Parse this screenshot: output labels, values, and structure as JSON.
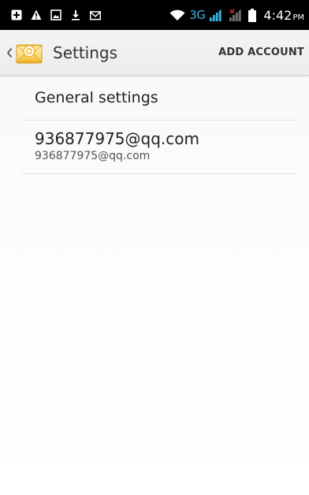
{
  "status_bar": {
    "left_icons": [
      "plus-badge-icon",
      "warning-icon",
      "image-icon",
      "download-icon",
      "gmail-icon"
    ],
    "network_type": "3G",
    "time": "4:42",
    "ampm": "PM",
    "accent_color": "#33b5e5"
  },
  "action_bar": {
    "title": "Settings",
    "action_label": "ADD ACCOUNT"
  },
  "list": {
    "general_label": "General settings",
    "accounts": [
      {
        "name": "936877975@qq.com",
        "email": "936877975@qq.com"
      }
    ]
  }
}
